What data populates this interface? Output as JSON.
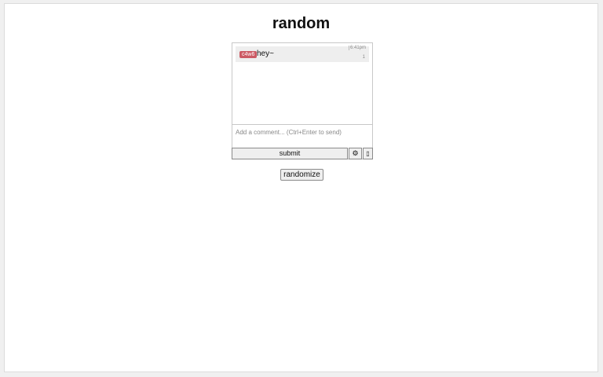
{
  "page": {
    "title": "random"
  },
  "chat": {
    "messages": [
      {
        "user": "c4w6",
        "text": "hey~",
        "time": "6:41pm",
        "mark": "1",
        "user_color": "#cc5a64"
      }
    ],
    "comment_placeholder": "Add a comment... (Ctrl+Enter to send)",
    "submit_label": "submit",
    "settings_icon": "gear-icon",
    "settings_glyph": "⚙",
    "extra_glyph": "▯"
  },
  "randomize_label": "randomize"
}
